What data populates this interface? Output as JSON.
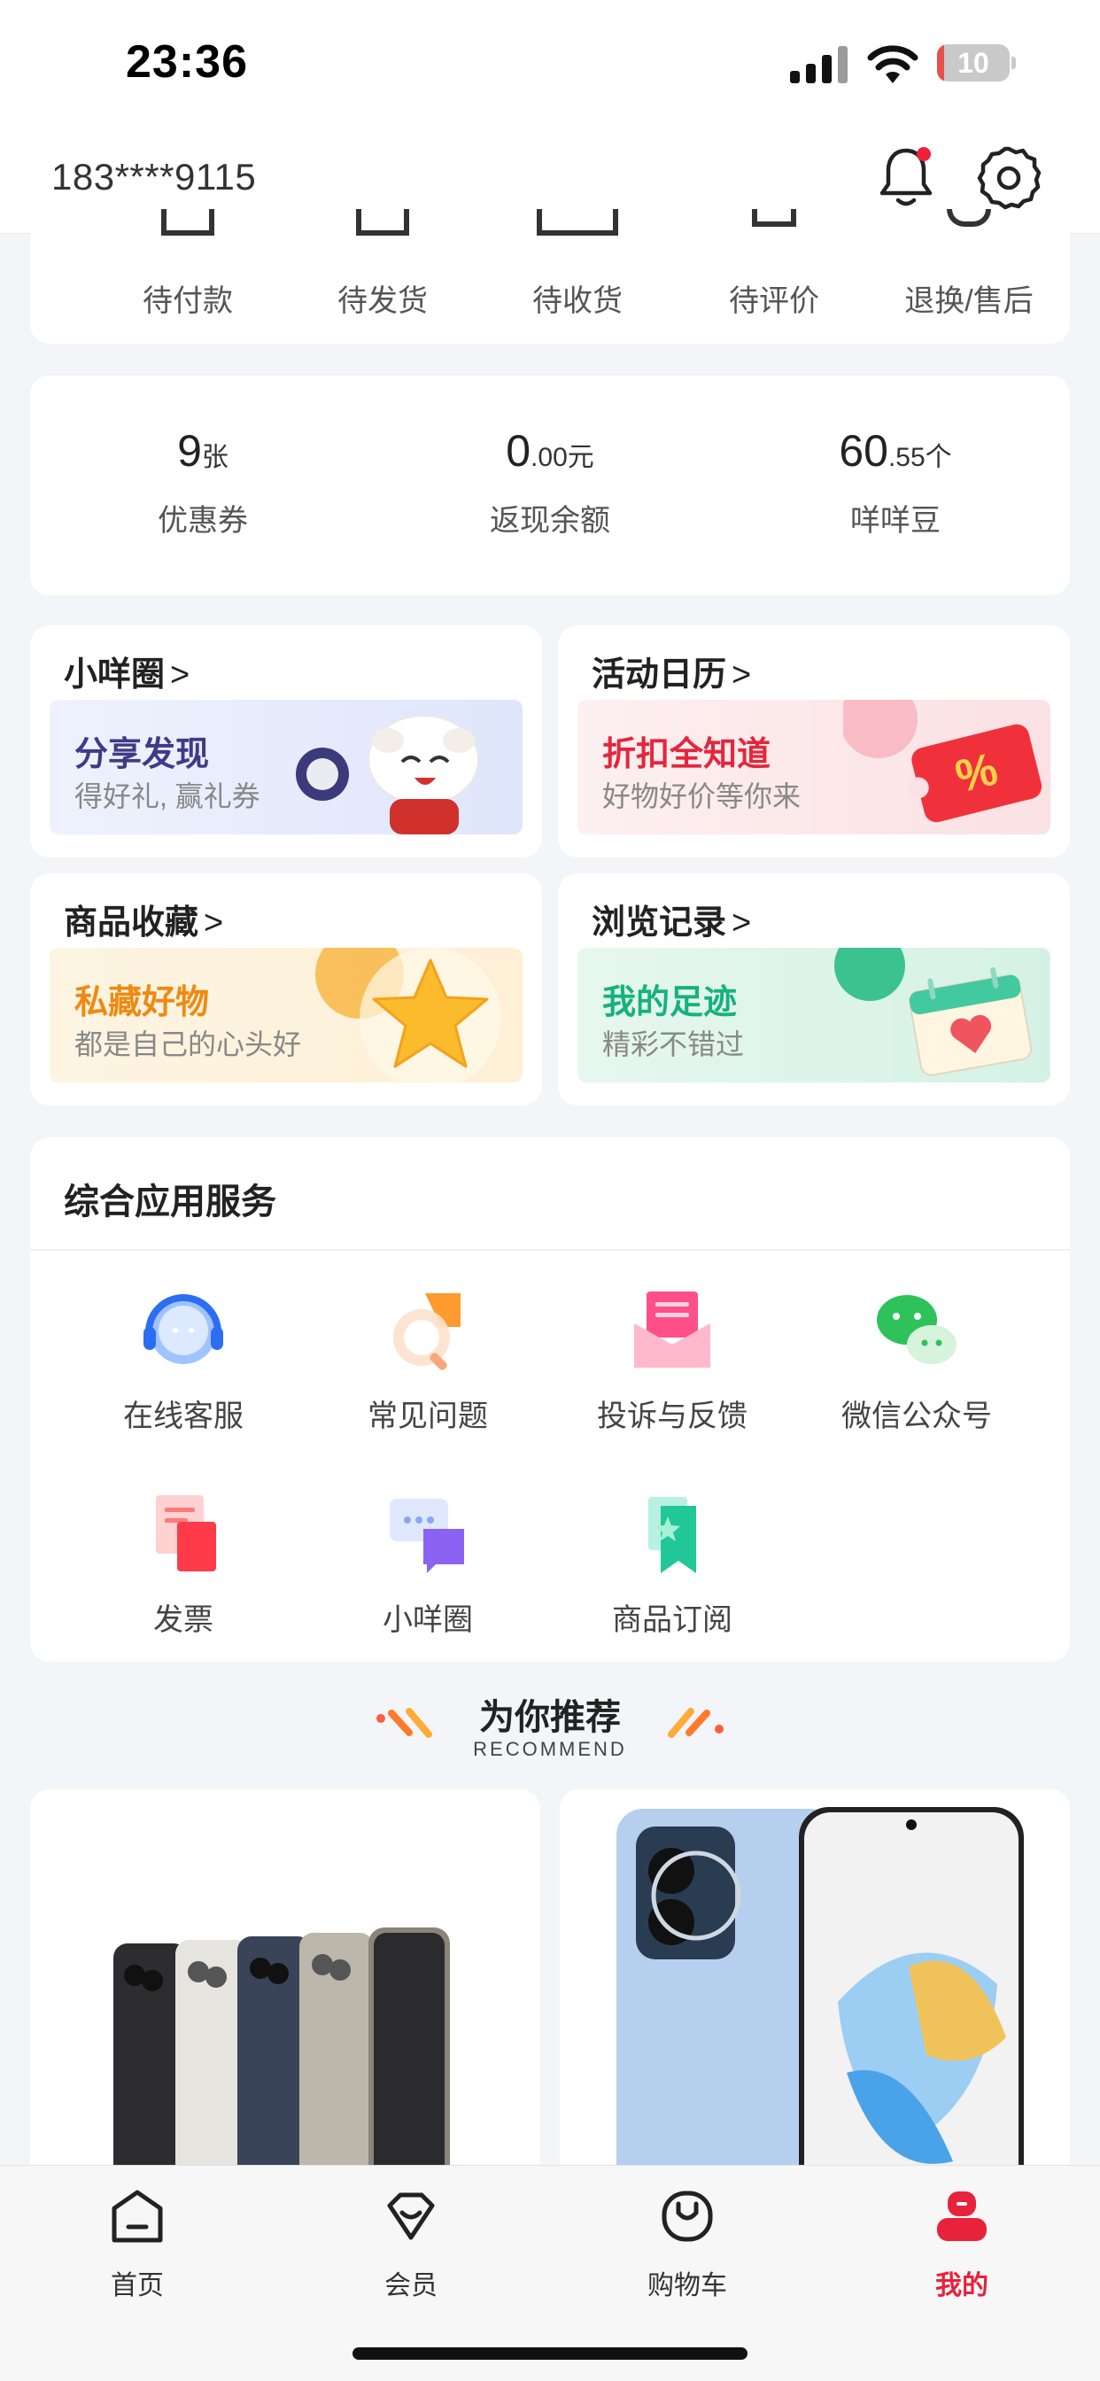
{
  "status_bar": {
    "time": "23:36",
    "battery": "10",
    "battery_level": 0.1
  },
  "header": {
    "phone": "183****9115"
  },
  "orders": {
    "items": [
      {
        "label": "待付款",
        "icon": "wallet-icon"
      },
      {
        "label": "待发货",
        "icon": "box-icon"
      },
      {
        "label": "待收货",
        "icon": "truck-icon"
      },
      {
        "label": "待评价",
        "icon": "comment-icon"
      },
      {
        "label": "退换/售后",
        "icon": "shield-icon"
      }
    ]
  },
  "stats": [
    {
      "int": "9",
      "dec": "",
      "unit": "张",
      "label": "优惠券"
    },
    {
      "int": "0",
      "dec": ".00",
      "unit": "元",
      "label": "返现余额"
    },
    {
      "int": "60",
      "dec": ".55",
      "unit": "个",
      "label": "咩咩豆"
    }
  ],
  "tiles": [
    {
      "title": "小咩圈",
      "chevron": ">",
      "main": "分享发现",
      "sub": "得好礼, 赢礼券",
      "main_color": "#3f3a88",
      "bg": "#e9eefc"
    },
    {
      "title": "活动日历",
      "chevron": ">",
      "main": "折扣全知道",
      "sub": "好物好价等你来",
      "main_color": "#e3263c",
      "bg": "#fdeeee"
    },
    {
      "title": "商品收藏",
      "chevron": ">",
      "main": "私藏好物",
      "sub": "都是自己的心头好",
      "main_color": "#ee8a12",
      "bg": "#fdf3de"
    },
    {
      "title": "浏览记录",
      "chevron": ">",
      "main": "我的足迹",
      "sub": "精彩不错过",
      "main_color": "#16b27a",
      "bg": "#e3f6ee"
    }
  ],
  "services": {
    "title": "综合应用服务",
    "items": [
      {
        "label": "在线客服",
        "icon": "headset-icon"
      },
      {
        "label": "常见问题",
        "icon": "question-icon"
      },
      {
        "label": "投诉与反馈",
        "icon": "envelope-icon"
      },
      {
        "label": "微信公众号",
        "icon": "wechat-icon"
      },
      {
        "label": "发票",
        "icon": "invoice-icon"
      },
      {
        "label": "小咩圈",
        "icon": "chat-bubbles-icon"
      },
      {
        "label": "商品订阅",
        "icon": "bookmark-icon"
      }
    ]
  },
  "recommend": {
    "title": "为你推荐",
    "subtitle": "RECOMMEND"
  },
  "tabbar": {
    "items": [
      {
        "label": "首页",
        "icon": "home-icon"
      },
      {
        "label": "会员",
        "icon": "member-icon"
      },
      {
        "label": "购物车",
        "icon": "cart-icon"
      },
      {
        "label": "我的",
        "icon": "profile-icon",
        "active": true
      }
    ],
    "active_color": "#e8223a"
  }
}
